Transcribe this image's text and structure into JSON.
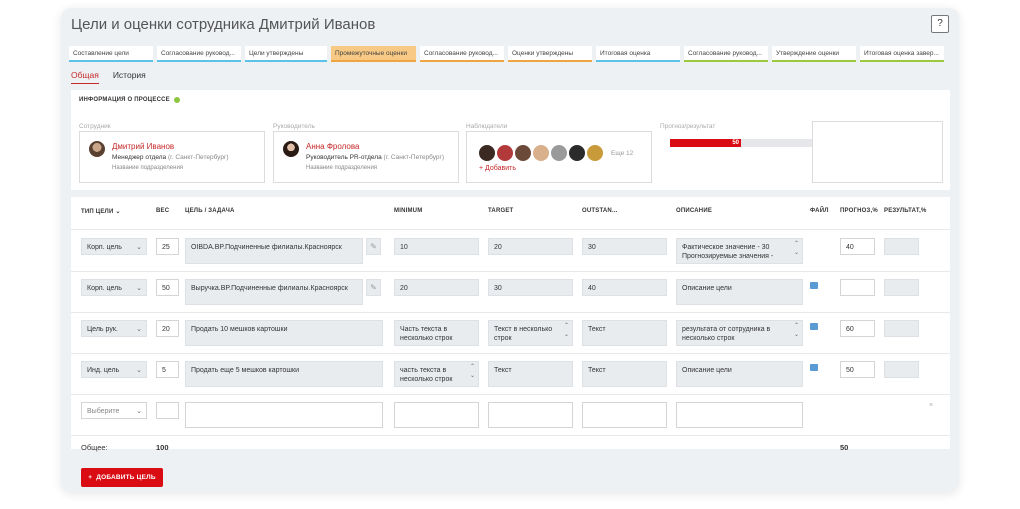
{
  "title": "Цели и оценки сотрудника Дмитрий Иванов",
  "help": "?",
  "stages": [
    "Составление цели",
    "Согласование руковод...",
    "Цели утверждены",
    "Промежуточные оценки",
    "Согласование руковод...",
    "Оценки утверждены",
    "Итоговая оценка",
    "Согласование руковод...",
    "Утверждение оценки",
    "Итоговая оценка завер..."
  ],
  "tabs": {
    "general": "Общая",
    "history": "История"
  },
  "info": {
    "header": "ИНФОРМАЦИЯ О ПРОЦЕССЕ",
    "employee_label": "Сотрудник",
    "manager_label": "Руководитель",
    "observers_label": "Наблюдатели",
    "forecast_label": "Прогноз/результат",
    "employee": {
      "name": "Дмитрий Иванов",
      "role": "Менеджер отдела",
      "city": "(г. Санкт-Петербург)",
      "dept": "Название подразделения"
    },
    "manager": {
      "name": "Анна Фролова",
      "role": "Руководитель PR-отдела",
      "city": "(г. Санкт-Петербург)",
      "dept": "Название подразделения"
    },
    "observers_more": "Еще 12",
    "add_observer": "+ Добавить",
    "progress_value": 50,
    "progress_text": "50"
  },
  "table": {
    "headers": {
      "type": "ТИП ЦЕЛИ",
      "weight": "ВЕС",
      "goal": "ЦЕЛЬ / ЗАДАЧА",
      "minimum": "MINIMUM",
      "target": "TARGET",
      "outstanding": "OUTSTAN...",
      "description": "ОПИСАНИЕ",
      "file": "ФАЙЛ",
      "forecast": "ПРОГНОЗ,%",
      "result": "РЕЗУЛЬТАТ,%"
    },
    "rows": [
      {
        "type": "Корп. цель",
        "weight": "25",
        "goal": "OIBDA.BP.Подчиненные филиалы.Красноярск",
        "minimum": "10",
        "target": "20",
        "outstanding": "30",
        "description": "Фактическое значение - 30 Прогнозируемые значения -",
        "forecast": "40",
        "result": ""
      },
      {
        "type": "Корп. цель",
        "weight": "50",
        "goal": "Выручка.BP.Подчиненные филиалы.Красноярск",
        "minimum": "20",
        "target": "30",
        "outstanding": "40",
        "description": "Описание цели",
        "forecast": "",
        "result": ""
      },
      {
        "type": "Цель рук.",
        "weight": "20",
        "goal": "Продать 10 мешков картошки",
        "minimum": "Часть текста в несколько строк",
        "target": "Текст в несколько строк",
        "outstanding": "Текст",
        "description": "результата от сотрудника в несколько строк",
        "forecast": "60",
        "result": ""
      },
      {
        "type": "Инд. цель",
        "weight": "5",
        "goal": "Продать еще 5 мешков картошки",
        "minimum": "часть текста в несколько строк и...",
        "target": "Текст",
        "outstanding": "Текст",
        "description": "Описание цели",
        "forecast": "50",
        "result": ""
      }
    ],
    "new_row_placeholder": "Выберите",
    "total_label": "Общее:",
    "total_weight": "100",
    "total_forecast": "50"
  },
  "add_goal_button": "ДОБАВИТЬ ЦЕЛЬ",
  "colors": {
    "accent": "#d90c14",
    "stage_blue": "#5bc3e8",
    "stage_orange": "#f0a640",
    "stage_green": "#9acb3c",
    "status_dot": "#8cc63f"
  }
}
